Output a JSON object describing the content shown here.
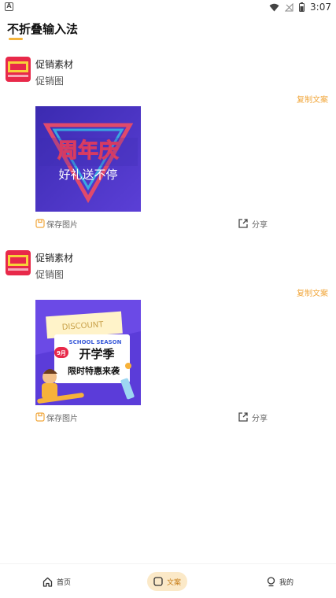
{
  "status_bar": {
    "time": "3:07",
    "left_icon": "A"
  },
  "header": {
    "title": "不折叠输入法"
  },
  "posts": [
    {
      "name": "促销素材",
      "subtitle": "促销图",
      "copy_label": "复制文案",
      "image": {
        "line1": "周年庆",
        "line2": "好礼送不停"
      },
      "save_label": "保存图片",
      "share_label": "分享"
    },
    {
      "name": "促销素材",
      "subtitle": "促销图",
      "copy_label": "复制文案",
      "image": {
        "tag": "SCHOOL SEASON",
        "badge": "9月",
        "line1": "开学季",
        "line2": "限时特惠来袭",
        "paper": "DISCOUNT"
      },
      "save_label": "保存图片",
      "share_label": "分享"
    }
  ],
  "tabbar": {
    "items": [
      {
        "label": "首页",
        "icon": "home-icon"
      },
      {
        "label": "文案",
        "icon": "copywriting-icon",
        "active": true
      },
      {
        "label": "我的",
        "icon": "profile-icon"
      }
    ]
  },
  "colors": {
    "accent": "#f1a73c",
    "tab_active_bg": "#fbe9c8"
  }
}
